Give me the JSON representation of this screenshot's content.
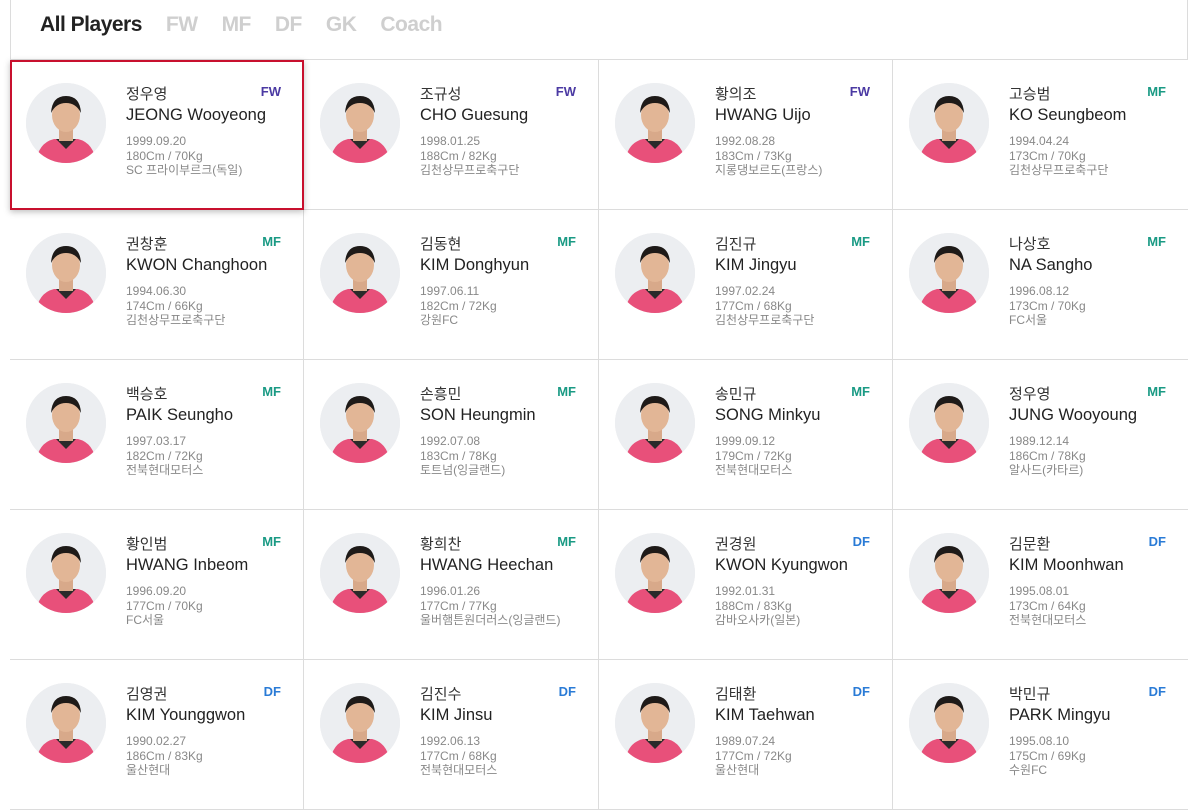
{
  "tabs": [
    "All Players",
    "FW",
    "MF",
    "DF",
    "GK",
    "Coach"
  ],
  "active_tab": "All Players",
  "colors": {
    "FW": "#4b3aa3",
    "MF": "#1a9a84",
    "DF": "#2a7bd6",
    "selected_border": "#c8102e",
    "kit": "#e8507a"
  },
  "players": [
    {
      "kname": "정우영",
      "ename": "JEONG Wooyeong",
      "pos": "FW",
      "dob": "1999.09.20",
      "body": "180Cm / 70Kg",
      "club": "SC 프라이부르크(독일)"
    },
    {
      "kname": "조규성",
      "ename": "CHO Guesung",
      "pos": "FW",
      "dob": "1998.01.25",
      "body": "188Cm / 82Kg",
      "club": "김천상무프로축구단"
    },
    {
      "kname": "황의조",
      "ename": "HWANG Uijo",
      "pos": "FW",
      "dob": "1992.08.28",
      "body": "183Cm / 73Kg",
      "club": "지롱댕보르도(프랑스)"
    },
    {
      "kname": "고승범",
      "ename": "KO Seungbeom",
      "pos": "MF",
      "dob": "1994.04.24",
      "body": "173Cm / 70Kg",
      "club": "김천상무프로축구단"
    },
    {
      "kname": "권창훈",
      "ename": "KWON Changhoon",
      "pos": "MF",
      "dob": "1994.06.30",
      "body": "174Cm / 66Kg",
      "club": "김천상무프로축구단"
    },
    {
      "kname": "김동현",
      "ename": "KIM Donghyun",
      "pos": "MF",
      "dob": "1997.06.11",
      "body": "182Cm / 72Kg",
      "club": "강원FC"
    },
    {
      "kname": "김진규",
      "ename": "KIM Jingyu",
      "pos": "MF",
      "dob": "1997.02.24",
      "body": "177Cm / 68Kg",
      "club": "김천상무프로축구단"
    },
    {
      "kname": "나상호",
      "ename": "NA Sangho",
      "pos": "MF",
      "dob": "1996.08.12",
      "body": "173Cm / 70Kg",
      "club": "FC서울"
    },
    {
      "kname": "백승호",
      "ename": "PAIK Seungho",
      "pos": "MF",
      "dob": "1997.03.17",
      "body": "182Cm / 72Kg",
      "club": "전북현대모터스"
    },
    {
      "kname": "손흥민",
      "ename": "SON Heungmin",
      "pos": "MF",
      "dob": "1992.07.08",
      "body": "183Cm / 78Kg",
      "club": "토트넘(잉글랜드)"
    },
    {
      "kname": "송민규",
      "ename": "SONG Minkyu",
      "pos": "MF",
      "dob": "1999.09.12",
      "body": "179Cm / 72Kg",
      "club": "전북현대모터스"
    },
    {
      "kname": "정우영",
      "ename": "JUNG Wooyoung",
      "pos": "MF",
      "dob": "1989.12.14",
      "body": "186Cm / 78Kg",
      "club": "알사드(카타르)"
    },
    {
      "kname": "황인범",
      "ename": "HWANG Inbeom",
      "pos": "MF",
      "dob": "1996.09.20",
      "body": "177Cm / 70Kg",
      "club": "FC서울"
    },
    {
      "kname": "황희찬",
      "ename": "HWANG Heechan",
      "pos": "MF",
      "dob": "1996.01.26",
      "body": "177Cm / 77Kg",
      "club": "울버햄튼원더러스(잉글랜드)"
    },
    {
      "kname": "권경원",
      "ename": "KWON Kyungwon",
      "pos": "DF",
      "dob": "1992.01.31",
      "body": "188Cm / 83Kg",
      "club": "감바오사카(일본)"
    },
    {
      "kname": "김문환",
      "ename": "KIM Moonhwan",
      "pos": "DF",
      "dob": "1995.08.01",
      "body": "173Cm / 64Kg",
      "club": "전북현대모터스"
    },
    {
      "kname": "김영권",
      "ename": "KIM Younggwon",
      "pos": "DF",
      "dob": "1990.02.27",
      "body": "186Cm / 83Kg",
      "club": "울산현대"
    },
    {
      "kname": "김진수",
      "ename": "KIM Jinsu",
      "pos": "DF",
      "dob": "1992.06.13",
      "body": "177Cm / 68Kg",
      "club": "전북현대모터스"
    },
    {
      "kname": "김태환",
      "ename": "KIM Taehwan",
      "pos": "DF",
      "dob": "1989.07.24",
      "body": "177Cm / 72Kg",
      "club": "울산현대"
    },
    {
      "kname": "박민규",
      "ename": "PARK Mingyu",
      "pos": "DF",
      "dob": "1995.08.10",
      "body": "175Cm / 69Kg",
      "club": "수원FC"
    }
  ]
}
